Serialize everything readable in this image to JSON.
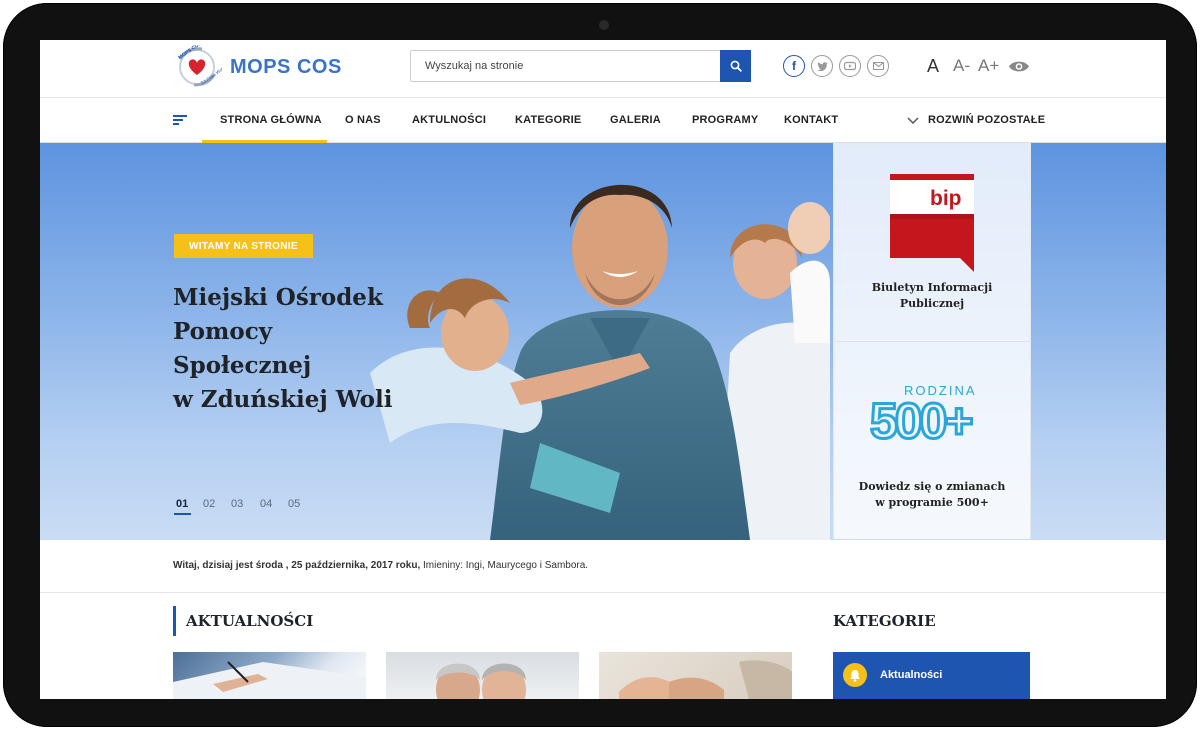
{
  "header": {
    "logo_text": "MOPS COS",
    "logo_ring_top": "MOPS COS",
    "logo_ring_bottom": "Zduńska Wola",
    "search_placeholder": "Wyszukaj na stronie",
    "social": [
      "facebook-icon",
      "twitter-icon",
      "youtube-icon",
      "mail-icon"
    ],
    "font_controls": {
      "normal": "A",
      "decrease": "A-",
      "increase": "A+"
    }
  },
  "nav": {
    "items": [
      "STRONA GŁÓWNA",
      "O NAS",
      "AKTULNOŚCI",
      "KATEGORIE",
      "GALERIA",
      "PROGRAMY",
      "KONTAKT"
    ],
    "more": "ROZWIŃ POZOSTAŁE",
    "active_index": 0
  },
  "hero": {
    "badge": "WITAMY NA STRONIE",
    "title_lines": [
      "Miejski Ośrodek",
      "Pomocy",
      "Społecznej",
      "w Zduńskiej Woli"
    ],
    "slides": [
      "01",
      "02",
      "03",
      "04",
      "05"
    ],
    "active_slide": 0
  },
  "side": {
    "bip_logo": "bip",
    "bip_text_lines": [
      "Biuletyn Informacji",
      "Publicznej"
    ],
    "r500_word": "RODZINA",
    "r500_number": "500+",
    "r500_text_lines": [
      "Dowiedz się o zmianach",
      "w programie 500+"
    ]
  },
  "info": {
    "greeting": "Witaj, dzisiaj jest środa , 25 października, 2017 roku,",
    "names": " Imieniny: Ingi, Maurycego i Sambora."
  },
  "sections": {
    "news_title": "AKTUALNOŚCI",
    "categories_title": "KATEGORIE",
    "category_items": [
      "Aktualności"
    ]
  },
  "colors": {
    "accent": "#1e55b0",
    "yellow": "#f5c118",
    "bip_red": "#c4161c"
  }
}
